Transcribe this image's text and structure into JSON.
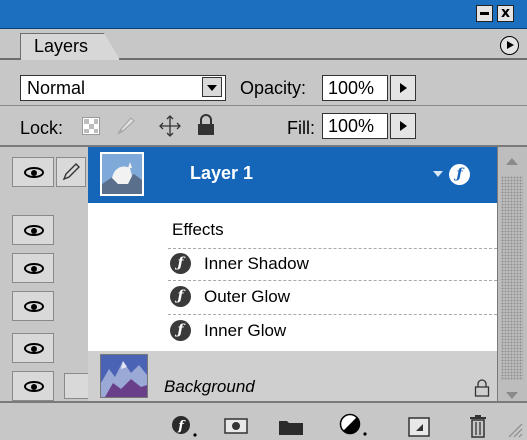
{
  "palette": {
    "title": "Layers",
    "title_bar_color": "#1c6ebf",
    "window_buttons": {
      "minimize": "minimize-icon",
      "close": "x"
    },
    "menu_icon": "palette-menu-arrow-icon"
  },
  "options": {
    "blend_mode": "Normal",
    "opacity_label": "Opacity:",
    "opacity_value": "100%",
    "lock_label": "Lock:",
    "fill_label": "Fill:",
    "fill_value": "100%"
  },
  "layers": [
    {
      "name": "Layer 1",
      "selected": true,
      "visible": true,
      "thumbnail": "mountain-goat-thumbnail",
      "effects_label": "Effects",
      "effects": [
        "Inner Shadow",
        "Outer Glow",
        "Inner Glow"
      ]
    },
    {
      "name": "Background",
      "selected": false,
      "visible": true,
      "locked": true,
      "thumbnail": "mountain-landscape-thumbnail"
    }
  ],
  "selection_color": "#1565b9",
  "toolbar": {
    "icons": [
      "layer-style-icon",
      "layer-mask-icon",
      "new-group-icon",
      "adjustment-layer-icon",
      "new-layer-icon",
      "delete-layer-icon"
    ]
  }
}
